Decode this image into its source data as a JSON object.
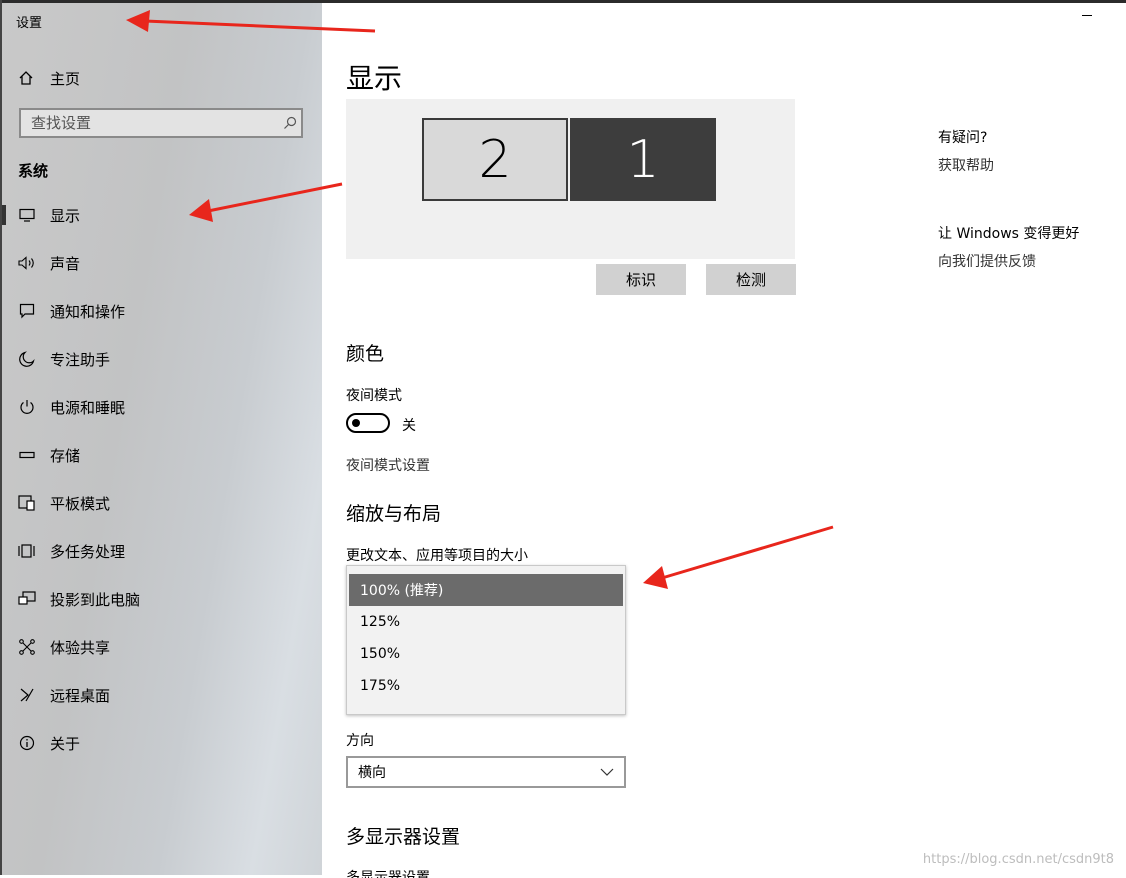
{
  "app": {
    "title": "设置"
  },
  "sidebar": {
    "home_label": "主页",
    "search_placeholder": "查找设置",
    "section_label": "系统",
    "items": [
      {
        "label": "显示",
        "icon": "monitor-icon",
        "active": true
      },
      {
        "label": "声音",
        "icon": "speaker-icon"
      },
      {
        "label": "通知和操作",
        "icon": "notification-icon"
      },
      {
        "label": "专注助手",
        "icon": "moon-icon"
      },
      {
        "label": "电源和睡眠",
        "icon": "power-icon"
      },
      {
        "label": "存储",
        "icon": "storage-icon"
      },
      {
        "label": "平板模式",
        "icon": "tablet-icon"
      },
      {
        "label": "多任务处理",
        "icon": "multitask-icon"
      },
      {
        "label": "投影到此电脑",
        "icon": "project-icon"
      },
      {
        "label": "体验共享",
        "icon": "share-icon"
      },
      {
        "label": "远程桌面",
        "icon": "remote-icon"
      },
      {
        "label": "关于",
        "icon": "info-icon"
      }
    ]
  },
  "main": {
    "title": "显示",
    "monitors": [
      "2",
      "1"
    ],
    "identify_button": "标识",
    "detect_button": "检测",
    "color_section": {
      "title": "颜色",
      "night_mode_label": "夜间模式",
      "night_mode_state": "关",
      "night_mode_settings_link": "夜间模式设置"
    },
    "scale_section": {
      "title": "缩放与布局",
      "scale_label": "更改文本、应用等项目的大小",
      "scale_options": [
        "100% (推荐)",
        "125%",
        "150%",
        "175%"
      ],
      "orientation_label": "方向",
      "orientation_value": "横向"
    },
    "multi_display_section": {
      "title": "多显示器设置",
      "subtitle": "多显示器设置"
    }
  },
  "right_panel": {
    "question_title": "有疑问?",
    "help_link": "获取帮助",
    "improve_title": "让 Windows 变得更好",
    "feedback_link": "向我们提供反馈"
  },
  "watermark": "https://blog.csdn.net/csdn9t8"
}
